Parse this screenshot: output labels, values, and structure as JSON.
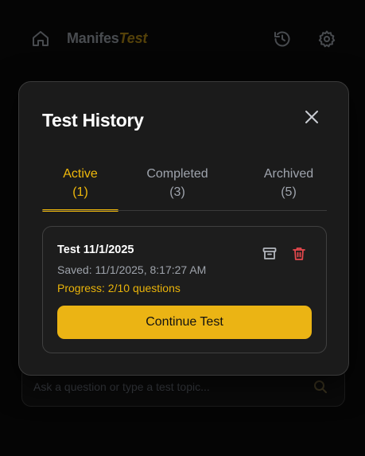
{
  "header": {
    "title_part1": "Manifes",
    "title_part2": "Test",
    "icons": {
      "home": "home-icon",
      "history": "history-icon",
      "settings": "gear-icon"
    }
  },
  "chat": {
    "placeholder": "Ask a question or type a test topic...",
    "search_icon": "search-icon"
  },
  "modal": {
    "title": "Test History",
    "close_icon": "close-icon",
    "tabs": [
      {
        "label": "Active",
        "count": "(1)",
        "active": true
      },
      {
        "label": "Completed",
        "count": "(3)",
        "active": false
      },
      {
        "label": "Archived",
        "count": "(5)",
        "active": false
      }
    ],
    "card": {
      "title": "Test 11/1/2025",
      "saved": "Saved: 11/1/2025, 8:17:27 AM",
      "progress": "Progress: 2/10 questions",
      "button_label": "Continue Test",
      "icons": {
        "archive": "archive-icon",
        "delete": "trash-icon"
      }
    }
  },
  "colors": {
    "accent": "#f0b90b",
    "button": "#ebb414",
    "delete": "#e5484d",
    "modal_bg": "#1b1b1b",
    "page_bg": "#050505"
  }
}
